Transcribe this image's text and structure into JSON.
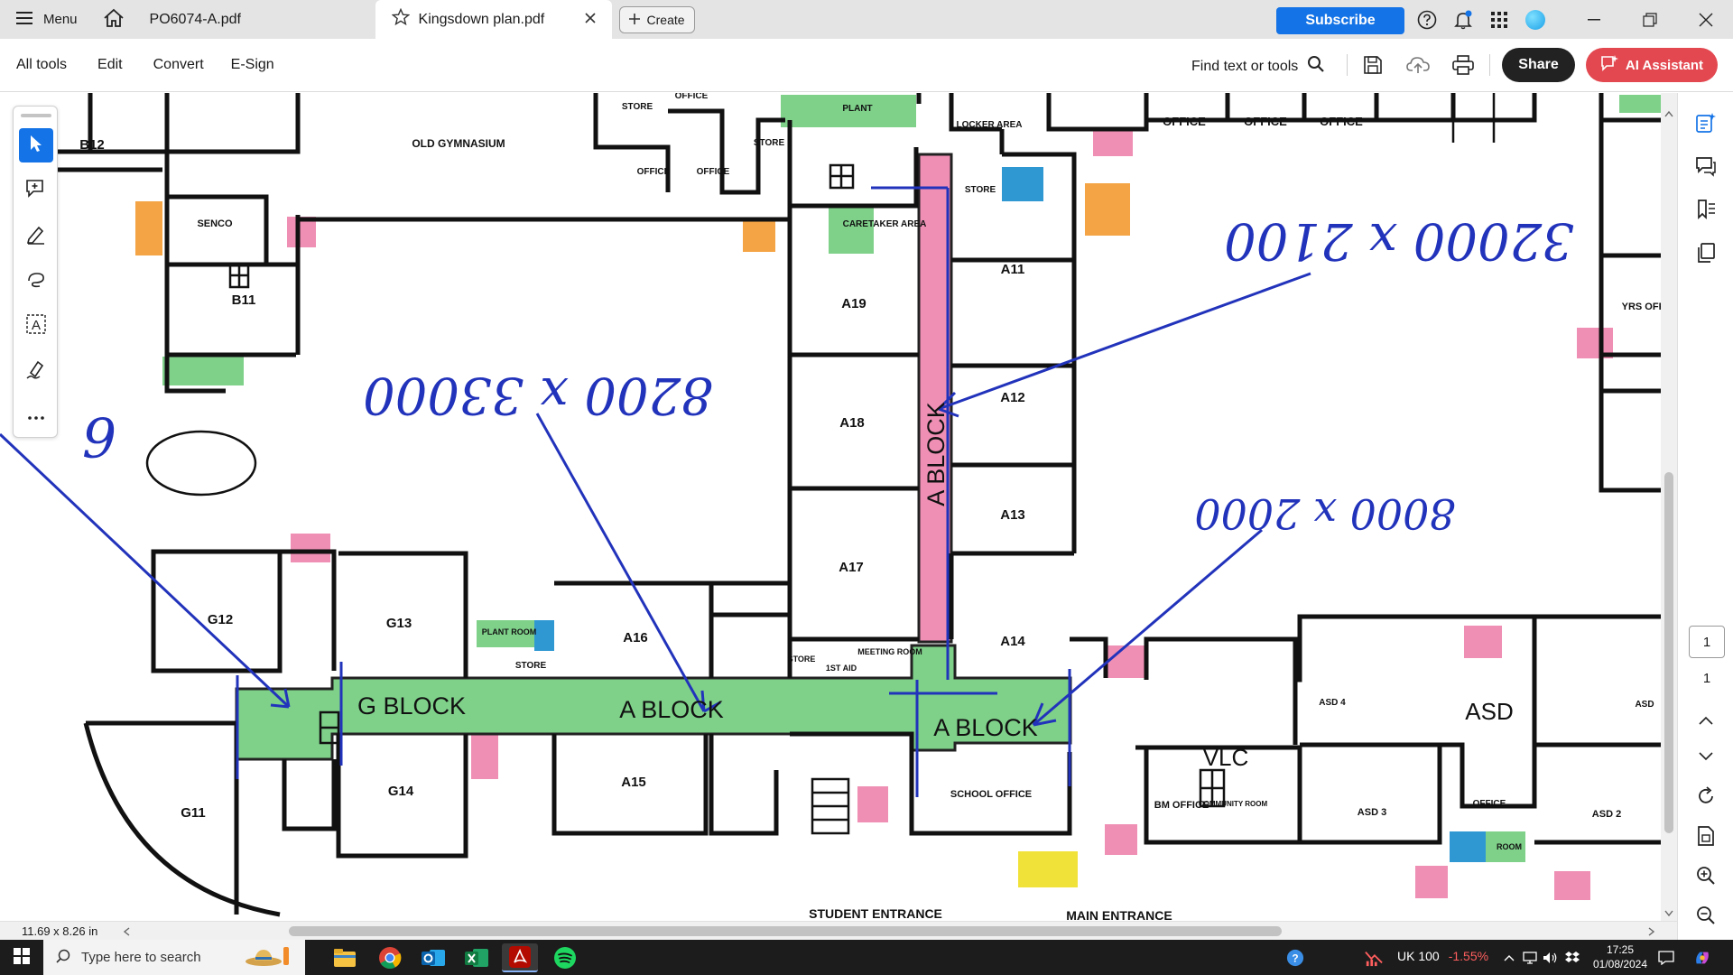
{
  "window": {
    "menu_label": "Menu",
    "tabs": [
      {
        "label": "PO6074-A.pdf"
      },
      {
        "label": "Kingsdown plan.pdf"
      }
    ],
    "create_label": "Create",
    "subscribe_label": "Subscribe"
  },
  "toolbar": {
    "menus": [
      "All tools",
      "Edit",
      "Convert",
      "E-Sign"
    ],
    "find_label": "Find text or tools",
    "share_label": "Share",
    "ai_label": "AI Assistant"
  },
  "document": {
    "rooms": {
      "b12": "B12",
      "old_gym": "OLD GYMNASIUM",
      "senco": "SENCO",
      "b11": "B11",
      "store1": "STORE",
      "office1": "OFFICE",
      "store2": "STORE",
      "office2": "OFFICE",
      "office3": "OFFICE",
      "plant1": "PLANT",
      "caretaker": "CARETAKER AREA",
      "locker": "LOCKER AREA",
      "store3": "STORE",
      "office_r1": "OFFICE",
      "office_r2": "OFFICE",
      "office_r3": "OFFICE",
      "yrs_office": "YRS OFFI",
      "a11": "A11",
      "a12": "A12",
      "a13": "A13",
      "a14": "A14",
      "a19": "A19",
      "a18": "A18",
      "a17": "A17",
      "a16": "A16",
      "a15": "A15",
      "g12": "G12",
      "g13": "G13",
      "g14": "G14",
      "g11": "G11",
      "plant2": "PLANT ROOM",
      "store4": "STORE",
      "store5": "STORE",
      "first_aid": "1ST AID",
      "meeting": "MEETING ROOM",
      "school_office": "SCHOOL OFFICE",
      "bm_office": "BM OFFICE",
      "community": "COMMUNITY ROOM",
      "vlc": "VLC",
      "asd": "ASD",
      "asd4": "ASD 4",
      "asd3": "ASD 3",
      "asd2": "ASD 2",
      "asd_r": "ASD",
      "office_s": "OFFICE",
      "room_s": "ROOM",
      "student_entrance": "STUDENT ENTRANCE",
      "main_entrance": "MAIN ENTRANCE"
    },
    "corridors": {
      "a_block_vertical": "A BLOCK",
      "g_block": "G BLOCK",
      "a_block_1": "A BLOCK",
      "a_block_2": "A BLOCK"
    },
    "annotations": {
      "dim1": "8200 x 33000",
      "dim2": "32000 x 2100",
      "dim3": "8000 x 2000",
      "partial": "6"
    }
  },
  "pager": {
    "current": "1",
    "total": "1"
  },
  "status": {
    "page_size": "11.69 x 8.26 in"
  },
  "taskbar": {
    "search_placeholder": "Type here to search",
    "stock_name": "UK 100",
    "stock_change": "-1.55%",
    "time": "17:25",
    "date": "01/08/2024"
  },
  "colors": {
    "accent_blue": "#1473e6",
    "ai_red": "#e34850",
    "corridor_green": "#7fd18a",
    "corridor_pink": "#ef8fb4",
    "ink_blue": "#2233bb"
  }
}
